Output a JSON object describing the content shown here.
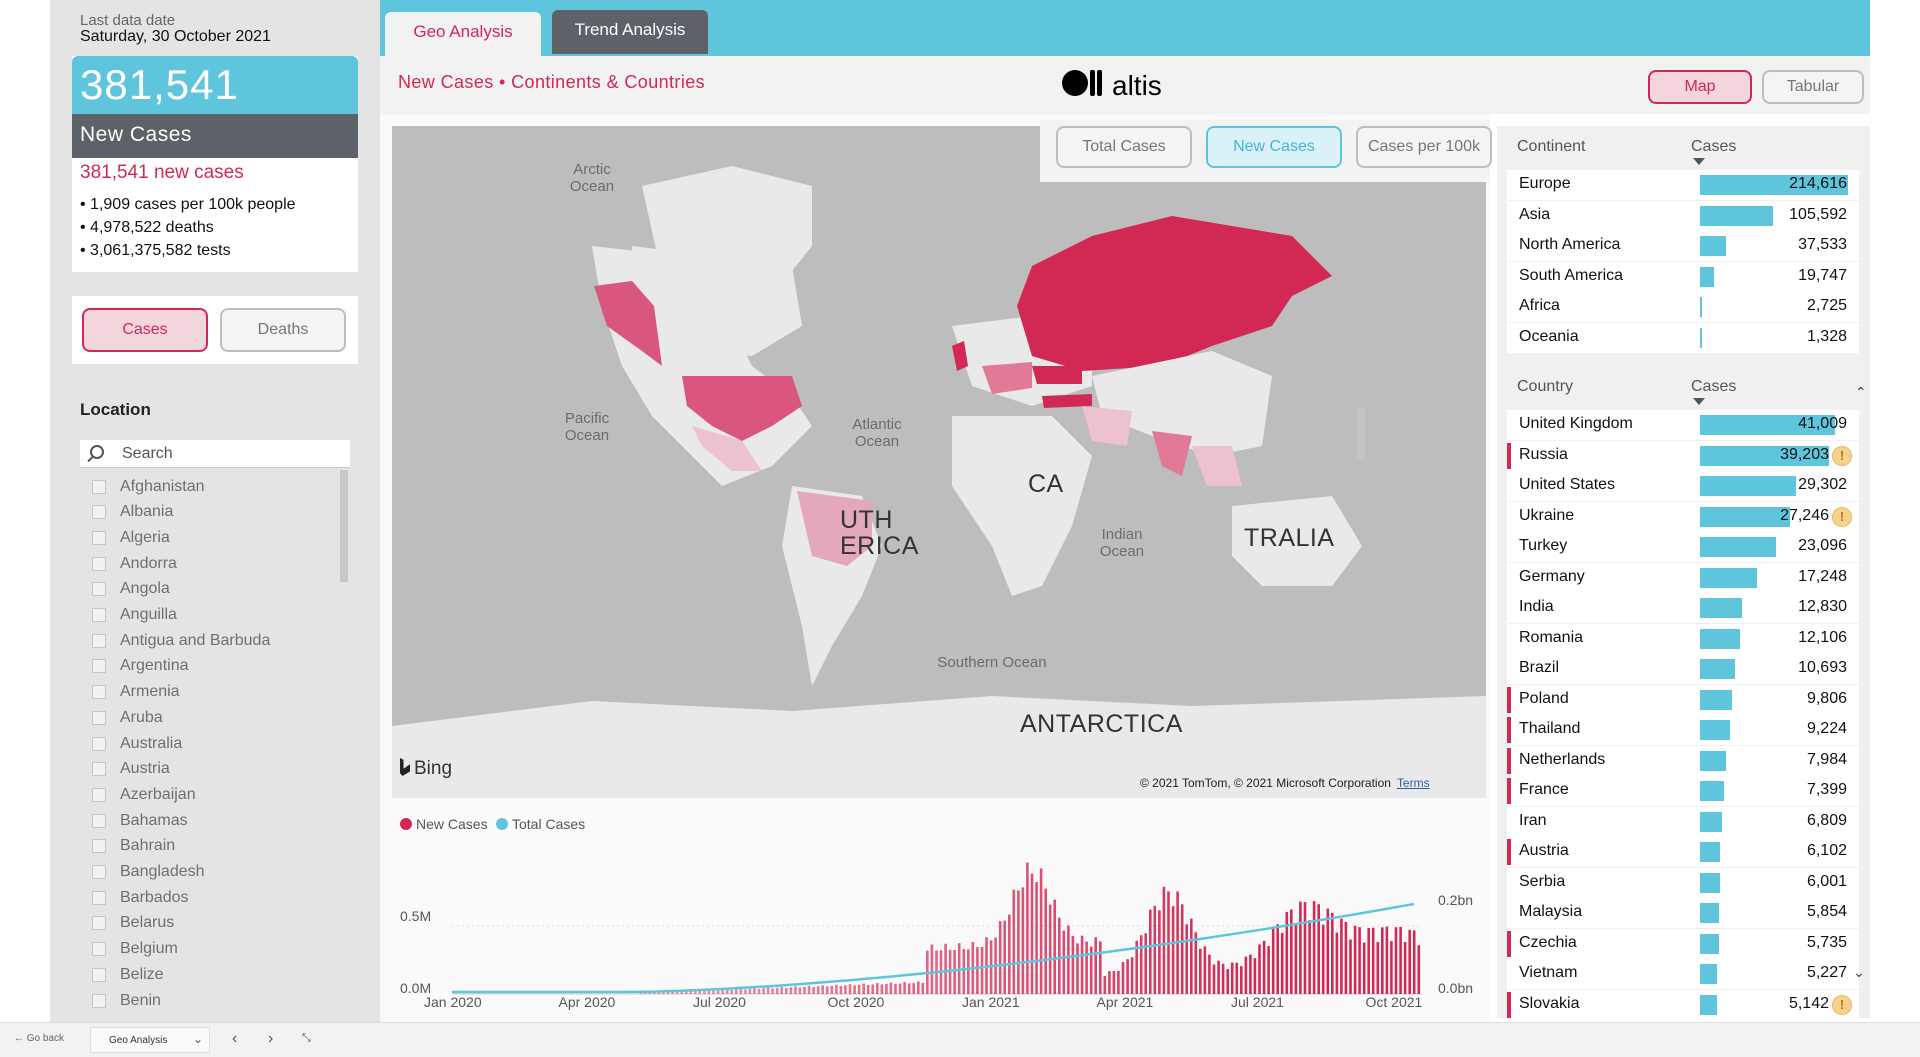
{
  "left_panel": {
    "last_date_label": "Last data date",
    "last_date_value": "Saturday, 30 October 2021",
    "kpi": {
      "value": "381,541",
      "label": "New Cases",
      "subtitle": "381,541 new cases",
      "bullets": [
        "• 1,909 cases per 100k people",
        "• 4,978,522 deaths",
        "• 3,061,375,582 tests"
      ]
    },
    "toggle": {
      "cases": "Cases",
      "deaths": "Deaths",
      "selected": "Cases"
    },
    "location": {
      "title": "Location",
      "search_placeholder": "Search",
      "items": [
        "Afghanistan",
        "Albania",
        "Algeria",
        "Andorra",
        "Angola",
        "Anguilla",
        "Antigua and Barbuda",
        "Argentina",
        "Armenia",
        "Aruba",
        "Australia",
        "Austria",
        "Azerbaijan",
        "Bahamas",
        "Bahrain",
        "Bangladesh",
        "Barbados",
        "Belarus",
        "Belgium",
        "Belize",
        "Benin"
      ]
    }
  },
  "tabs": [
    {
      "label": "Geo Analysis",
      "active": true
    },
    {
      "label": "Trend Analysis",
      "active": false
    }
  ],
  "header": {
    "subtitle": "New Cases • Continents & Countries",
    "logo_text": "altis",
    "view_buttons": {
      "map": "Map",
      "tabular": "Tabular",
      "selected": "Map"
    }
  },
  "map": {
    "metric_buttons": {
      "total": "Total Cases",
      "new": "New Cases",
      "per100k": "Cases per 100k",
      "selected": "New Cases"
    },
    "ocean_labels": {
      "arctic": "Arctic Ocean",
      "pacific": "Pacific Ocean",
      "atlantic": "Atlantic Ocean",
      "indian": "Indian Ocean",
      "southern": "Southern Ocean"
    },
    "land_labels": {
      "south_america_1": "UTH",
      "south_america_2": "ERICA",
      "africa": "CA",
      "australia": "TRALIA",
      "antarctica": "ANTARCTICA"
    },
    "bing": "Bing",
    "copyright": "© 2021 TomTom, © 2021 Microsoft Corporation",
    "terms": "Terms",
    "colors": {
      "high": "#d12953",
      "mid": "#e07a96",
      "low": "#ecc2cf",
      "land": "#e9e9e9",
      "water": "#bdbdbd"
    }
  },
  "timeline": {
    "legend": [
      {
        "name": "New Cases",
        "color": "#d12953"
      },
      {
        "name": "Total Cases",
        "color": "#5ec5dc"
      }
    ],
    "y_left_ticks": [
      "0.5M",
      "0.0M"
    ],
    "y_right_ticks": [
      "0.2bn",
      "0.0bn"
    ],
    "x_ticks": [
      "Jan 2020",
      "Apr 2020",
      "Jul 2020",
      "Oct 2020",
      "Jan 2021",
      "Apr 2021",
      "Jul 2021",
      "Oct 2021"
    ]
  },
  "continent_table": {
    "headers": {
      "name": "Continent",
      "value": "Cases"
    },
    "rows": [
      {
        "name": "Europe",
        "value": "214,616",
        "n": 214616
      },
      {
        "name": "Asia",
        "value": "105,592",
        "n": 105592
      },
      {
        "name": "North America",
        "value": "37,533",
        "n": 37533
      },
      {
        "name": "South America",
        "value": "19,747",
        "n": 19747
      },
      {
        "name": "Africa",
        "value": "2,725",
        "n": 2725
      },
      {
        "name": "Oceania",
        "value": "1,328",
        "n": 1328
      }
    ]
  },
  "country_table": {
    "headers": {
      "name": "Country",
      "value": "Cases"
    },
    "rows": [
      {
        "name": "United Kingdom",
        "value": "41,009",
        "n": 41009,
        "flag": false,
        "warn": false
      },
      {
        "name": "Russia",
        "value": "39,203",
        "n": 39203,
        "flag": true,
        "warn": true
      },
      {
        "name": "United States",
        "value": "29,302",
        "n": 29302,
        "flag": false,
        "warn": false
      },
      {
        "name": "Ukraine",
        "value": "27,246",
        "n": 27246,
        "flag": false,
        "warn": true
      },
      {
        "name": "Turkey",
        "value": "23,096",
        "n": 23096,
        "flag": false,
        "warn": false
      },
      {
        "name": "Germany",
        "value": "17,248",
        "n": 17248,
        "flag": false,
        "warn": false
      },
      {
        "name": "India",
        "value": "12,830",
        "n": 12830,
        "flag": false,
        "warn": false
      },
      {
        "name": "Romania",
        "value": "12,106",
        "n": 12106,
        "flag": false,
        "warn": false
      },
      {
        "name": "Brazil",
        "value": "10,693",
        "n": 10693,
        "flag": false,
        "warn": false
      },
      {
        "name": "Poland",
        "value": "9,806",
        "n": 9806,
        "flag": true,
        "warn": false
      },
      {
        "name": "Thailand",
        "value": "9,224",
        "n": 9224,
        "flag": true,
        "warn": false
      },
      {
        "name": "Netherlands",
        "value": "7,984",
        "n": 7984,
        "flag": true,
        "warn": false
      },
      {
        "name": "France",
        "value": "7,399",
        "n": 7399,
        "flag": true,
        "warn": false
      },
      {
        "name": "Iran",
        "value": "6,809",
        "n": 6809,
        "flag": false,
        "warn": false
      },
      {
        "name": "Austria",
        "value": "6,102",
        "n": 6102,
        "flag": true,
        "warn": false
      },
      {
        "name": "Serbia",
        "value": "6,001",
        "n": 6001,
        "flag": false,
        "warn": false
      },
      {
        "name": "Malaysia",
        "value": "5,854",
        "n": 5854,
        "flag": false,
        "warn": false
      },
      {
        "name": "Czechia",
        "value": "5,735",
        "n": 5735,
        "flag": true,
        "warn": false
      },
      {
        "name": "Vietnam",
        "value": "5,227",
        "n": 5227,
        "flag": false,
        "warn": false
      },
      {
        "name": "Slovakia",
        "value": "5,142",
        "n": 5142,
        "flag": true,
        "warn": true
      }
    ]
  },
  "bottom_bar": {
    "go_back": "Go back",
    "page": "Geo Analysis"
  }
}
